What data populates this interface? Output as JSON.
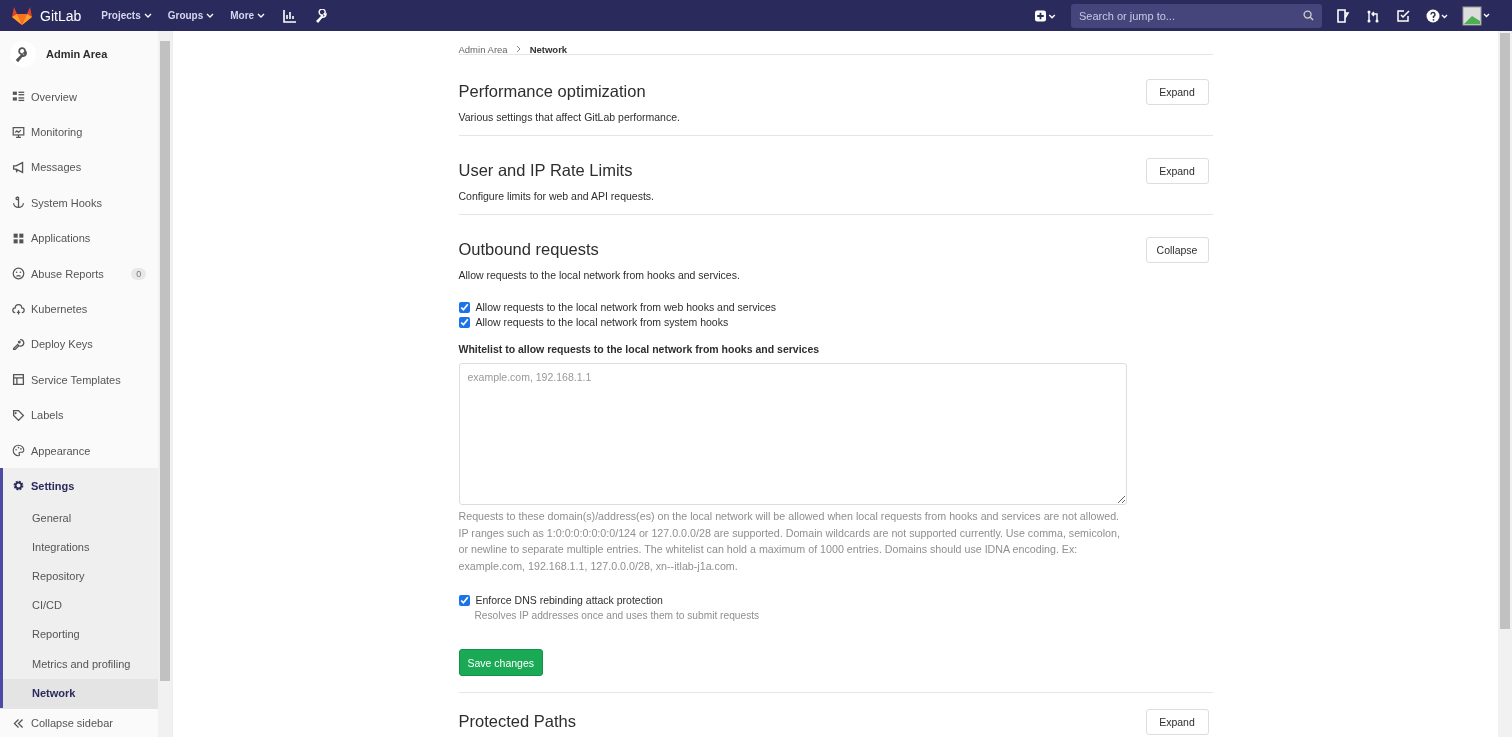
{
  "topbar": {
    "logo_text": "GitLab",
    "menus": [
      {
        "label": "Projects"
      },
      {
        "label": "Groups"
      },
      {
        "label": "More"
      }
    ],
    "search": {
      "placeholder": "Search or jump to..."
    }
  },
  "sidebar": {
    "header": "Admin Area",
    "items": [
      {
        "label": "Overview",
        "selected": false
      },
      {
        "label": "Monitoring",
        "selected": false
      },
      {
        "label": "Messages",
        "selected": false
      },
      {
        "label": "System Hooks",
        "selected": false
      },
      {
        "label": "Applications",
        "selected": false
      },
      {
        "label": "Abuse Reports",
        "selected": false,
        "badge": "0"
      },
      {
        "label": "Kubernetes",
        "selected": false
      },
      {
        "label": "Deploy Keys",
        "selected": false
      },
      {
        "label": "Service Templates",
        "selected": false
      },
      {
        "label": "Labels",
        "selected": false
      },
      {
        "label": "Appearance",
        "selected": false
      },
      {
        "label": "Settings",
        "selected": true,
        "children": [
          {
            "label": "General",
            "selected": false
          },
          {
            "label": "Integrations",
            "selected": false
          },
          {
            "label": "Repository",
            "selected": false
          },
          {
            "label": "CI/CD",
            "selected": false
          },
          {
            "label": "Reporting",
            "selected": false
          },
          {
            "label": "Metrics and profiling",
            "selected": false
          },
          {
            "label": "Network",
            "selected": true
          }
        ]
      }
    ],
    "collapse_label": "Collapse sidebar"
  },
  "breadcrumb": [
    "Admin Area",
    "Network"
  ],
  "sections": [
    {
      "title": "Performance optimization",
      "description": "Various settings that affect GitLab performance.",
      "button": "Expand"
    },
    {
      "title": "User and IP Rate Limits",
      "description": "Configure limits for web and API requests.",
      "button": "Expand"
    },
    {
      "title": "Outbound requests",
      "description": "Allow requests to the local network from hooks and services.",
      "button": "Collapse",
      "form": {
        "checkboxes": [
          {
            "label": "Allow requests to the local network from web hooks and services",
            "checked": true
          },
          {
            "label": "Allow requests to the local network from system hooks",
            "checked": true
          }
        ],
        "whitelist_label": "Whitelist to allow requests to the local network from hooks and services",
        "whitelist_placeholder": "example.com, 192.168.1.1",
        "whitelist_help": "Requests to these domain(s)/address(es) on the local network will be allowed when local requests from hooks and services are not allowed. IP ranges such as 1:0:0:0:0:0:0:0/124 or 127.0.0.0/28 are supported. Domain wildcards are not supported currently. Use comma, semicolon, or newline to separate multiple entries. The whitelist can hold a maximum of 1000 entries. Domains should use IDNA encoding. Ex: example.com, 192.168.1.1, 127.0.0.0/28, xn--itlab-j1a.com.",
        "dns": {
          "label": "Enforce DNS rebinding attack protection",
          "checked": true,
          "help": "Resolves IP addresses once and uses them to submit requests"
        },
        "save": "Save changes"
      }
    },
    {
      "title": "Protected Paths",
      "button": "Expand"
    }
  ]
}
